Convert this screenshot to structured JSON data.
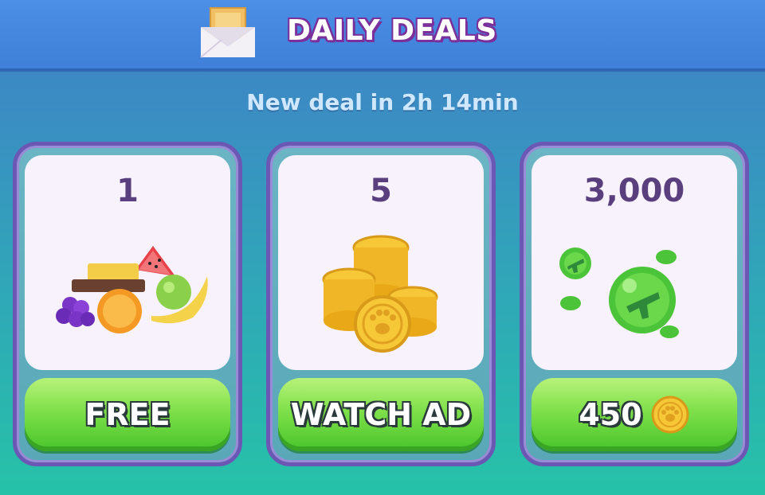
{
  "header": {
    "title": "DAILY DEALS",
    "icon": "envelope-icon"
  },
  "timer_text": "New deal in 2h 14min",
  "deals": [
    {
      "quantity": "1",
      "item_icon": "fruit-bundle-icon",
      "button_label": "FREE"
    },
    {
      "quantity": "5",
      "item_icon": "paw-coins-stack-icon",
      "button_label": "WATCH AD"
    },
    {
      "quantity": "3,000",
      "item_icon": "green-bubbles-icon",
      "button_label": "450",
      "price_icon": "paw-coin-icon"
    }
  ],
  "colors": {
    "accent_purple": "#7b2f9a",
    "button_green": "#7ee04a",
    "card_border": "#6b58b5"
  }
}
